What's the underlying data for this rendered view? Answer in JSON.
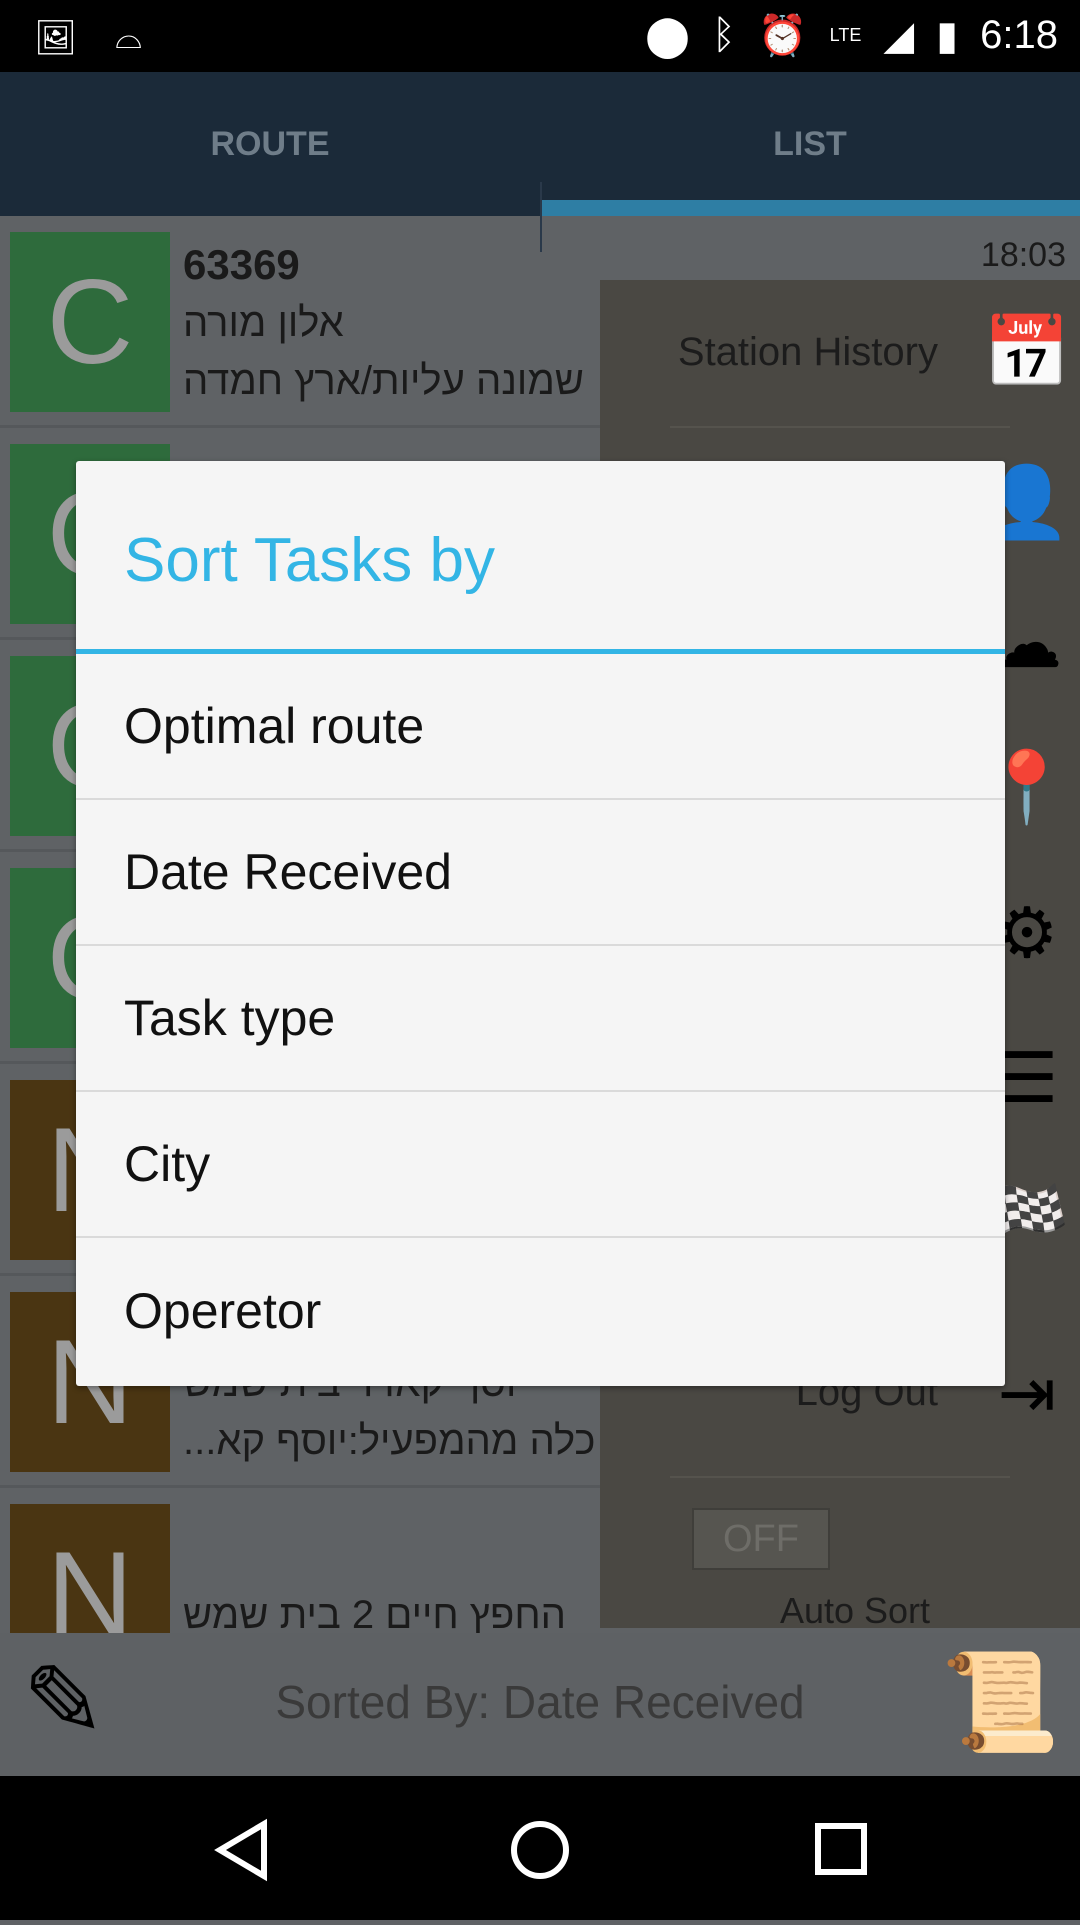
{
  "status_bar": {
    "time": "6:18",
    "network": "LTE",
    "icons": [
      "image-icon",
      "voicemail-icon",
      "location-icon",
      "bluetooth-icon",
      "alarm-icon",
      "signal-icon",
      "battery-icon"
    ]
  },
  "tabs": [
    {
      "label": "ROUTE",
      "active": false
    },
    {
      "label": "LIST",
      "active": true
    }
  ],
  "tasks": [
    {
      "letter": "C",
      "color": "#2e6b3c",
      "number": "63369",
      "time": "18:03",
      "line1": "אלון מורה",
      "line2": "שמונה עליות/ארץ חמדה"
    },
    {
      "letter": "C",
      "color": "#2e6b3c"
    },
    {
      "letter": "C",
      "color": "#2e6b3c"
    },
    {
      "letter": "C",
      "color": "#2e6b3c"
    },
    {
      "letter": "N",
      "color": "#4a3512"
    },
    {
      "letter": "N",
      "color": "#4a3512",
      "line1": "יוסף קאדר בית שמש",
      "line2": "כלה מהמפעיל:יוסף קא..."
    },
    {
      "letter": "N",
      "color": "#4a3512",
      "line1": "החפץ חיים 2 בית שמש"
    }
  ],
  "drawer": {
    "station_history": "Station History",
    "log_out": "Log Out",
    "auto_sort_toggle": "OFF",
    "auto_sort_label": "Auto Sort"
  },
  "bottom_bar": {
    "sorted_by": "Sorted By: Date Received"
  },
  "dialog": {
    "title": "Sort Tasks by",
    "accent": "#33b5e5",
    "options": [
      "Optimal route",
      "Date Received",
      "Task type",
      "City",
      "Operetor"
    ]
  }
}
